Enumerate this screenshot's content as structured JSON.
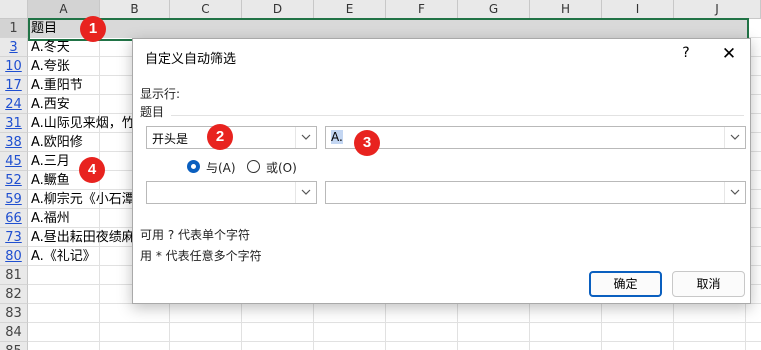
{
  "sheet": {
    "columns": [
      "A",
      "B",
      "C",
      "D",
      "E",
      "F",
      "G",
      "H",
      "I",
      "J"
    ],
    "rows": [
      {
        "num": "1",
        "text": "题目"
      },
      {
        "num": "3",
        "text": "A.冬天"
      },
      {
        "num": "10",
        "text": "A.夸张"
      },
      {
        "num": "17",
        "text": "A.重阳节"
      },
      {
        "num": "24",
        "text": "A.西安"
      },
      {
        "num": "31",
        "text": "A.山际见来烟，竹"
      },
      {
        "num": "38",
        "text": "A.欧阳修"
      },
      {
        "num": "45",
        "text": "A.三月"
      },
      {
        "num": "52",
        "text": "A.鳜鱼"
      },
      {
        "num": "59",
        "text": "A.柳宗元《小石潭"
      },
      {
        "num": "66",
        "text": "A.福州"
      },
      {
        "num": "73",
        "text": "A.昼出耘田夜绩麻"
      },
      {
        "num": "80",
        "text": "A.《礼记》"
      },
      {
        "num": "81",
        "text": ""
      },
      {
        "num": "82",
        "text": ""
      },
      {
        "num": "83",
        "text": ""
      },
      {
        "num": "84",
        "text": ""
      },
      {
        "num": "85",
        "text": ""
      }
    ]
  },
  "badges": [
    "1",
    "2",
    "3",
    "4"
  ],
  "dialog": {
    "title": "自定义自动筛选",
    "help": "?",
    "close": "✕",
    "show_rows_label": "显示行:",
    "field_label": "题目",
    "condition1": {
      "operator": "开头是",
      "value": "A."
    },
    "logic": {
      "and_label": "与(A)",
      "or_label": "或(O)",
      "selected": "and"
    },
    "condition2": {
      "operator": "",
      "value": ""
    },
    "hint1": "可用 ? 代表单个字符",
    "hint2": "用 * 代表任意多个字符",
    "ok_label": "确定",
    "cancel_label": "取消"
  },
  "colors": {
    "accent": "#0a5fbf",
    "badge": "#e8231f",
    "selection_border": "#217346"
  }
}
